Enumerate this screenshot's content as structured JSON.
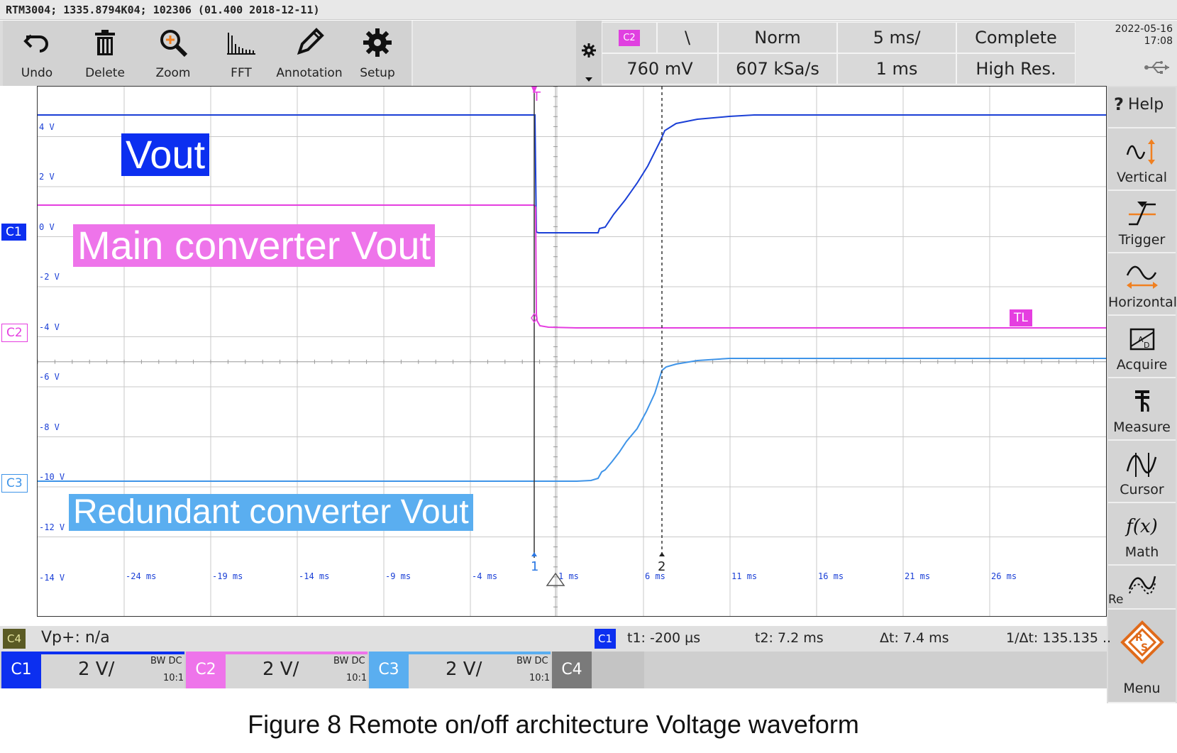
{
  "titlebar": {
    "text": "RTM3004; 1335.8794K04; 102306 (01.400 2018-12-11)"
  },
  "toolbar": {
    "undo": "Undo",
    "delete": "Delete",
    "zoom": "Zoom",
    "fft": "FFT",
    "annotation": "Annotation",
    "setup": "Setup"
  },
  "trigger": {
    "source": "C2",
    "slope_glyph": "\\",
    "level": "760 mV",
    "mode": "Norm",
    "sample_rate": "607 kSa/s",
    "timebase": "5 ms/",
    "position": "1 ms",
    "acq_state": "Complete",
    "acq_mode": "High Res."
  },
  "datetime": {
    "date": "2022-05-16",
    "time": "17:08"
  },
  "sidebar": {
    "help": "Help",
    "vertical": "Vertical",
    "trigger": "Trigger",
    "horizontal": "Horizontal",
    "acquire": "Acquire",
    "measure": "Measure",
    "cursor": "Cursor",
    "math": "Math",
    "menu": "Menu",
    "truncated": "Re"
  },
  "screen": {
    "y_labels": [
      "4 V",
      "2 V",
      "0 V",
      "-2 V",
      "-4 V",
      "-6 V",
      "-8 V",
      "-10 V",
      "-12 V",
      "-14 V"
    ],
    "x_labels": [
      "-24 ms",
      "-19 ms",
      "-14 ms",
      "-9 ms",
      "-4 ms",
      "1 ms",
      "6 ms",
      "11 ms",
      "16 ms",
      "21 ms",
      "26 ms"
    ],
    "ch_markers": {
      "c1": "C1",
      "c2": "C2",
      "c3": "C3",
      "tl": "TL",
      "trig_T": "T",
      "cursor1": "1",
      "cursor2": "2"
    },
    "labels": {
      "vout": "Vout",
      "main": "Main converter Vout",
      "redundant": "Redundant converter Vout"
    }
  },
  "traces": {
    "c1_color": "#1a3fd6",
    "c2_color": "#e53ee0",
    "c3_color": "#3f94e8"
  },
  "cursorbar": {
    "source_tag": "C4",
    "vp": "Vp+: n/a",
    "cursor_source": "C1",
    "t1": "t1: -200 µs",
    "t2": "t2: 7.2 ms",
    "dt": "Δt: 7.4 ms",
    "inv_dt": "1/Δt: 135.135 .."
  },
  "channels": [
    {
      "name": "C1",
      "scale": "2 V/",
      "bw": "BW DC",
      "probe": "10:1",
      "color": "#0c2ff0"
    },
    {
      "name": "C2",
      "scale": "2 V/",
      "bw": "BW DC",
      "probe": "10:1",
      "color": "#ee74ea"
    },
    {
      "name": "C3",
      "scale": "2 V/",
      "bw": "BW DC",
      "probe": "10:1",
      "color": "#5aaef0"
    },
    {
      "name": "C4"
    }
  ],
  "caption": "Figure 8 Remote on/off architecture Voltage waveform"
}
